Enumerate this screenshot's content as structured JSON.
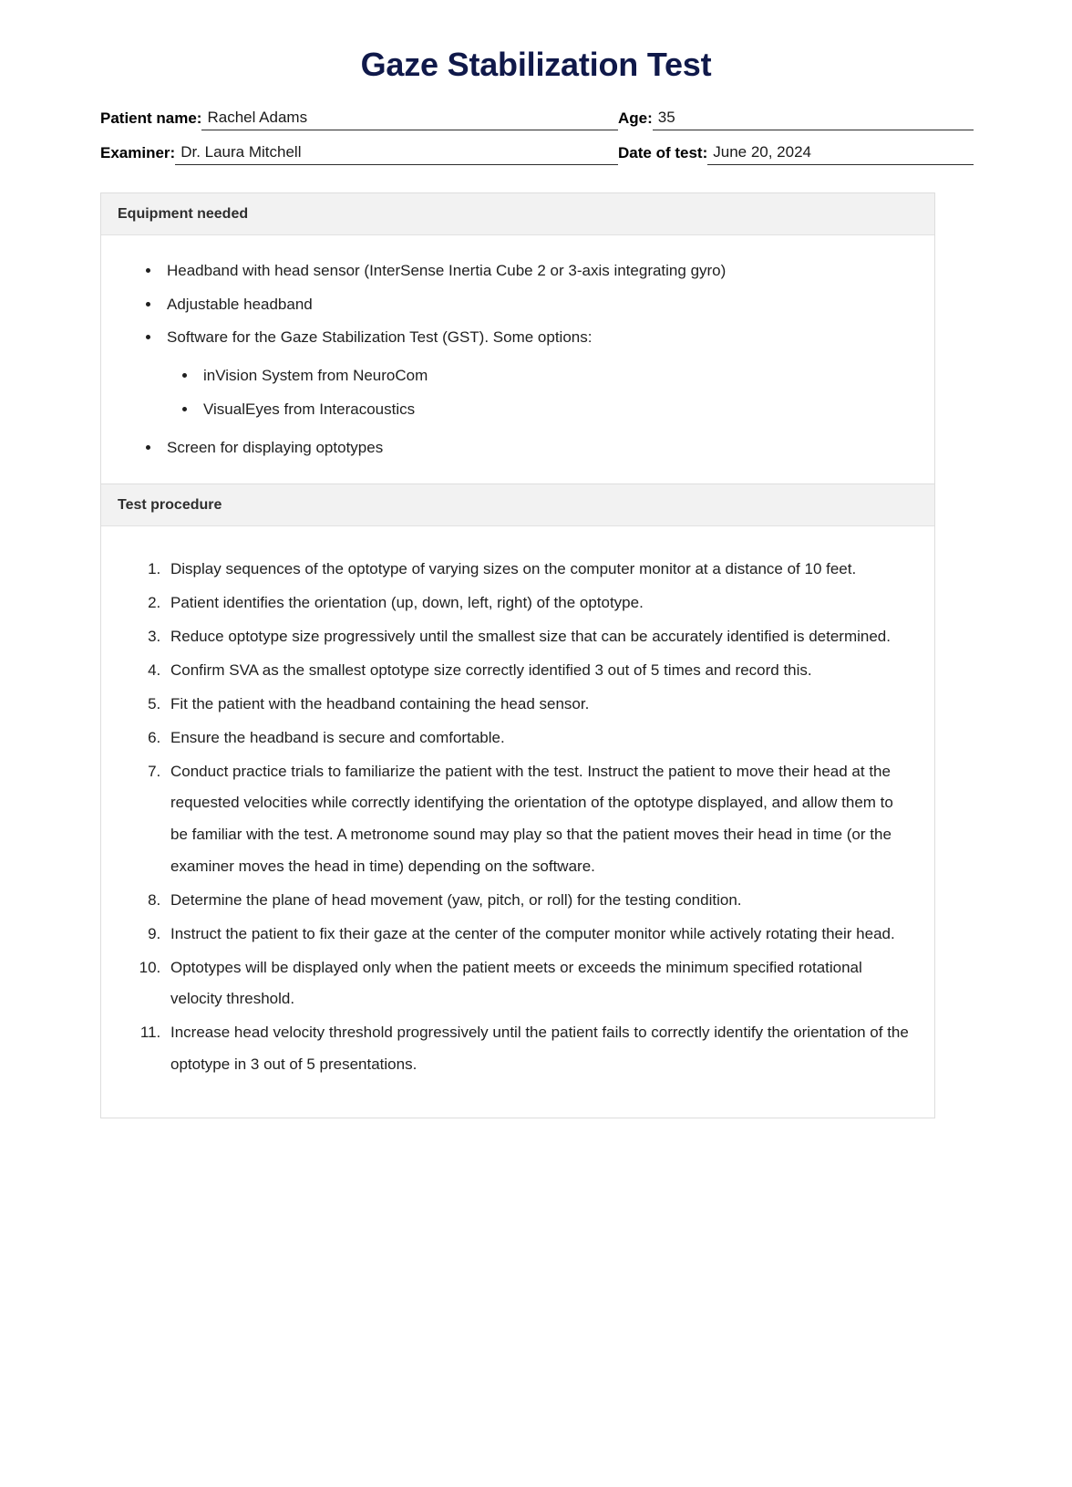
{
  "document": {
    "title": "Gaze Stabilization Test"
  },
  "patient_form": {
    "fields": [
      {
        "label": "Patient name:",
        "value": "Rachel Adams"
      },
      {
        "label": "Age:",
        "value": "35"
      },
      {
        "label": "Examiner:",
        "value": "Dr. Laura Mitchell"
      },
      {
        "label": "Date of test:",
        "value": "June 20, 2024"
      }
    ]
  },
  "equipment": {
    "header": "Equipment needed",
    "items": [
      "Headband with head sensor (InterSense Inertia Cube 2 or 3-axis integrating gyro)",
      "Adjustable headband",
      "Software for the Gaze Stabilization Test (GST). Some options:",
      "Screen for displaying optotypes"
    ],
    "software_options": [
      "inVision System from NeuroCom",
      "VisualEyes from Interacoustics"
    ]
  },
  "procedure": {
    "header": "Test procedure",
    "steps": [
      "Display sequences of the optotype of varying sizes on the computer monitor at a distance of 10 feet.",
      "Patient identifies the orientation (up, down, left, right) of the optotype.",
      "Reduce optotype size progressively until the smallest size that can be accurately identified is determined.",
      "Confirm SVA as the smallest optotype size correctly identified 3 out of 5 times and record this.",
      "Fit the patient with the headband containing the head sensor.",
      "Ensure the headband is secure and comfortable.",
      "Conduct practice trials to familiarize the patient with the test. Instruct the patient to move their head at the requested velocities while correctly identifying the orientation of the optotype displayed, and allow them to be familiar with the test. A metronome sound may play so that the patient moves their head in time (or the examiner moves the head in time) depending on the software.",
      "Determine the plane of head movement (yaw, pitch, or roll) for the testing condition.",
      "Instruct the patient to fix their gaze at the center of the computer monitor while actively rotating their head.",
      "Optotypes will be displayed only when the patient meets or exceeds the minimum specified rotational velocity threshold.",
      "Increase head velocity threshold progressively until the patient fails to correctly identify the orientation of the optotype in 3 out of 5 presentations."
    ]
  },
  "colors": {
    "title": "#10194a",
    "panel_header_bg": "#f2f2f2",
    "panel_border": "#dddddd",
    "text": "#1f1f1f"
  }
}
